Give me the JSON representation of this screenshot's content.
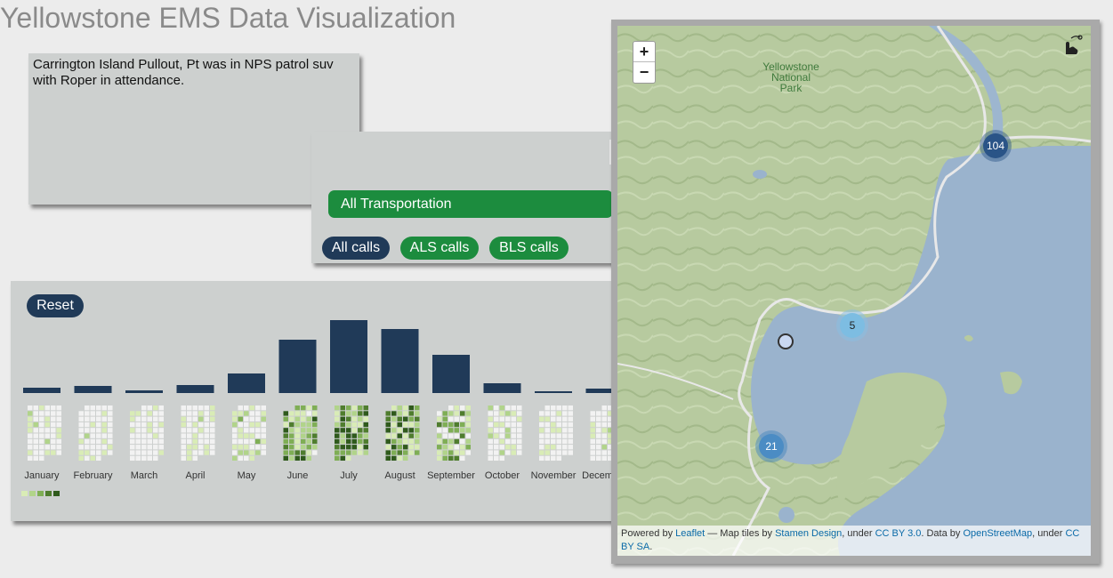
{
  "page_title": "Yellowstone EMS Data Visualization",
  "description": {
    "text": "Carrington Island Pullout, Pt was in NPS patrol suv with Roper in attendance."
  },
  "filters": {
    "transport_label": "All Transportation",
    "call_types": [
      "All calls",
      "ALS calls",
      "BLS calls"
    ],
    "active_call_type": "All calls"
  },
  "colors": {
    "navy": "#203a58",
    "green": "#1c8c3e",
    "panel": "#cdd0cf",
    "heat": [
      "#f2f2f2",
      "#d9ecb6",
      "#b1d48a",
      "#7fae55",
      "#4f7d2e",
      "#2f5a1c"
    ]
  },
  "chart": {
    "reset_label": "Reset",
    "chart_data": {
      "type": "bar",
      "categories": [
        "January",
        "February",
        "March",
        "April",
        "May",
        "June",
        "July",
        "August",
        "September",
        "October",
        "November",
        "December"
      ],
      "values": [
        6,
        8,
        3,
        9,
        22,
        60,
        82,
        72,
        43,
        11,
        2,
        5
      ],
      "ylim": [
        0,
        82
      ]
    },
    "heatmap_legend_levels": 5
  },
  "map": {
    "zoom_in": "+",
    "zoom_out": "−",
    "park_label_1": "Yellowstone National",
    "park_label_2": "Park",
    "clusters": [
      {
        "count": "104",
        "level": "dark"
      },
      {
        "count": "5",
        "level": "light"
      },
      {
        "count": "21",
        "level": "medium"
      }
    ],
    "attribution": {
      "prefix": "Powered by",
      "leaflet": "Leaflet",
      "tiles_text": "— Map tiles by",
      "stamen": "Stamen Design",
      "under1": ", under",
      "ccby": "CC BY 3.0",
      "data_text": ". Data by",
      "osm": "OpenStreetMap",
      "under2": ", under",
      "ccbysa": "CC BY SA",
      "suffix": "."
    }
  }
}
